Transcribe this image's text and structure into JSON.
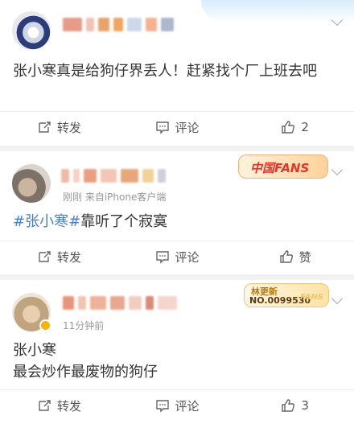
{
  "posts": [
    {
      "text": "张小寒真是给狗仔界丢人！赶紧找个厂上班去吧",
      "meta": "",
      "actions": {
        "repost": "转发",
        "comment": "评论",
        "like": "2"
      }
    },
    {
      "meta": "刚刚  来自iPhone客户端",
      "topic": "#张小寒#",
      "text_after_topic": "靠听了个寂寞",
      "badge": "中国FANS",
      "actions": {
        "repost": "转发",
        "comment": "评论",
        "like": "赞"
      }
    },
    {
      "meta": "11分钟前",
      "text_lines": [
        "张小寒",
        "最会炒作最废物的狗仔"
      ],
      "badge": {
        "line1": "林更新",
        "line2": "NO.0099530",
        "line3": "FANS"
      },
      "actions": {
        "repost": "转发",
        "comment": "评论",
        "like": "3"
      }
    }
  ]
}
